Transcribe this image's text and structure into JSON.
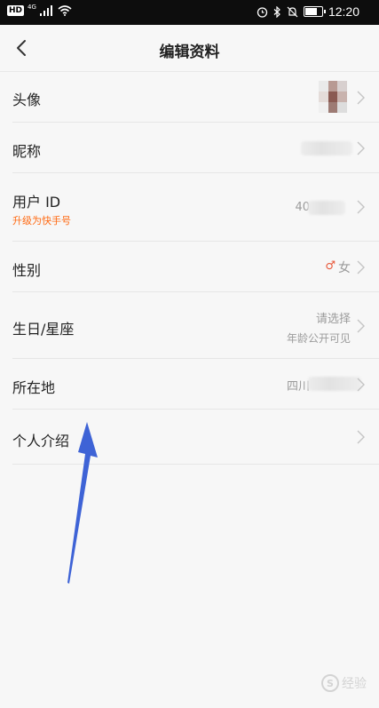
{
  "status_bar": {
    "network": "HD",
    "signal_gen": "4G",
    "time": "12:20",
    "battery_level": 0.75
  },
  "header": {
    "title": "编辑资料"
  },
  "rows": {
    "avatar": {
      "label": "头像"
    },
    "nickname": {
      "label": "昵称"
    },
    "user_id": {
      "label": "用户 ID",
      "sublabel": "升级为快手号",
      "value_prefix": "40"
    },
    "gender": {
      "label": "性别",
      "gender_symbol": "♂",
      "value": "女"
    },
    "birthday": {
      "label": "生日/星座",
      "value": "请选择",
      "hint": "年龄公开可见"
    },
    "location": {
      "label": "所在地",
      "value_prefix": "四川"
    },
    "bio": {
      "label": "个人介绍"
    }
  },
  "watermark": {
    "text": "经验",
    "logo": "S"
  },
  "colors": {
    "accent_orange": "#ff6a13",
    "gender_icon": "#e8583a",
    "arrow_blue": "#3e63d6"
  }
}
